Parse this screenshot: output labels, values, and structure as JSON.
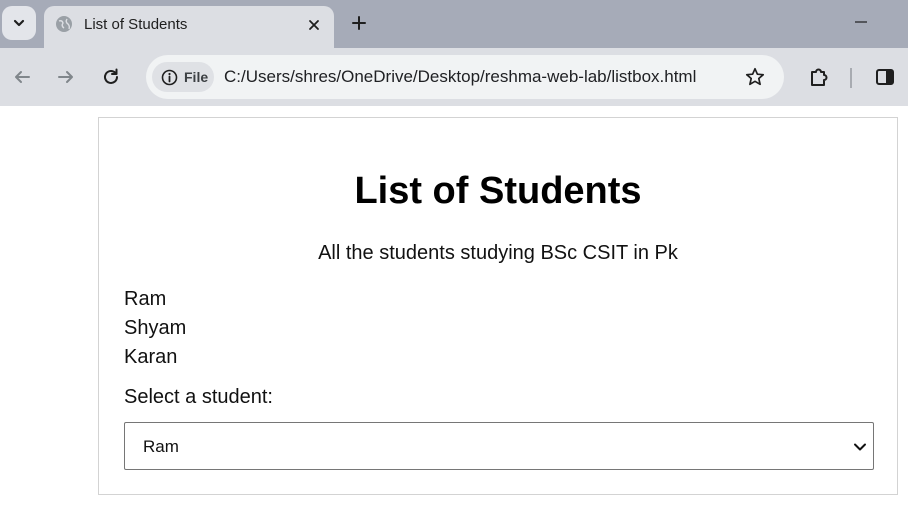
{
  "browser": {
    "tab_title": "List of Students",
    "site_chip_label": "File",
    "url": "C:/Users/shres/OneDrive/Desktop/reshma-web-lab/listbox.html"
  },
  "icons": {
    "tab_search": "chevron-down-icon",
    "favicon": "globe-icon",
    "close": "close-icon",
    "new_tab": "plus-icon",
    "minimize": "minimize-icon",
    "back": "arrow-left-icon",
    "forward": "arrow-right-icon",
    "reload": "reload-icon",
    "site_info": "info-icon",
    "bookmark": "star-icon",
    "extensions": "puzzle-icon",
    "side_panel": "side-panel-icon"
  },
  "page": {
    "title": "List of Students",
    "subtitle": "All the students studying BSc CSIT in Pk",
    "students": [
      "Ram",
      "Shyam",
      "Karan"
    ],
    "select_label": "Select a student:",
    "select_value": "Ram"
  },
  "colors": {
    "tabstrip": "#a6abb8",
    "toolbar": "#dcdee3",
    "omnibox": "#f1f3f4"
  }
}
